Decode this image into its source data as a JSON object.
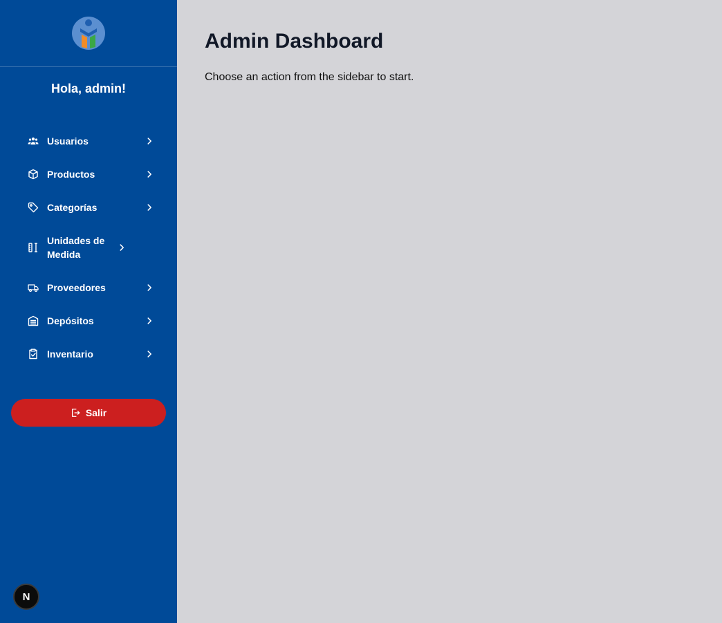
{
  "sidebar": {
    "greeting": "Hola, admin!",
    "items": [
      {
        "label": "Usuarios",
        "icon": "users-icon"
      },
      {
        "label": "Productos",
        "icon": "box-icon"
      },
      {
        "label": "Categorías",
        "icon": "tag-icon"
      },
      {
        "label": "Unidades de Medida",
        "icon": "ruler-icon"
      },
      {
        "label": "Proveedores",
        "icon": "truck-icon"
      },
      {
        "label": "Depósitos",
        "icon": "warehouse-icon"
      },
      {
        "label": "Inventario",
        "icon": "clipboard-check-icon"
      }
    ],
    "logout_label": "Salir"
  },
  "main": {
    "title": "Admin Dashboard",
    "subtitle": "Choose an action from the sidebar to start."
  },
  "devtools": {
    "badge": "N"
  },
  "colors": {
    "sidebar_bg": "#004a98",
    "main_bg": "#d4d4d8",
    "logout_bg": "#cc1f1f",
    "logo_orange": "#f28c28",
    "logo_green": "#3aa845",
    "logo_blue": "#2a6cc0"
  }
}
